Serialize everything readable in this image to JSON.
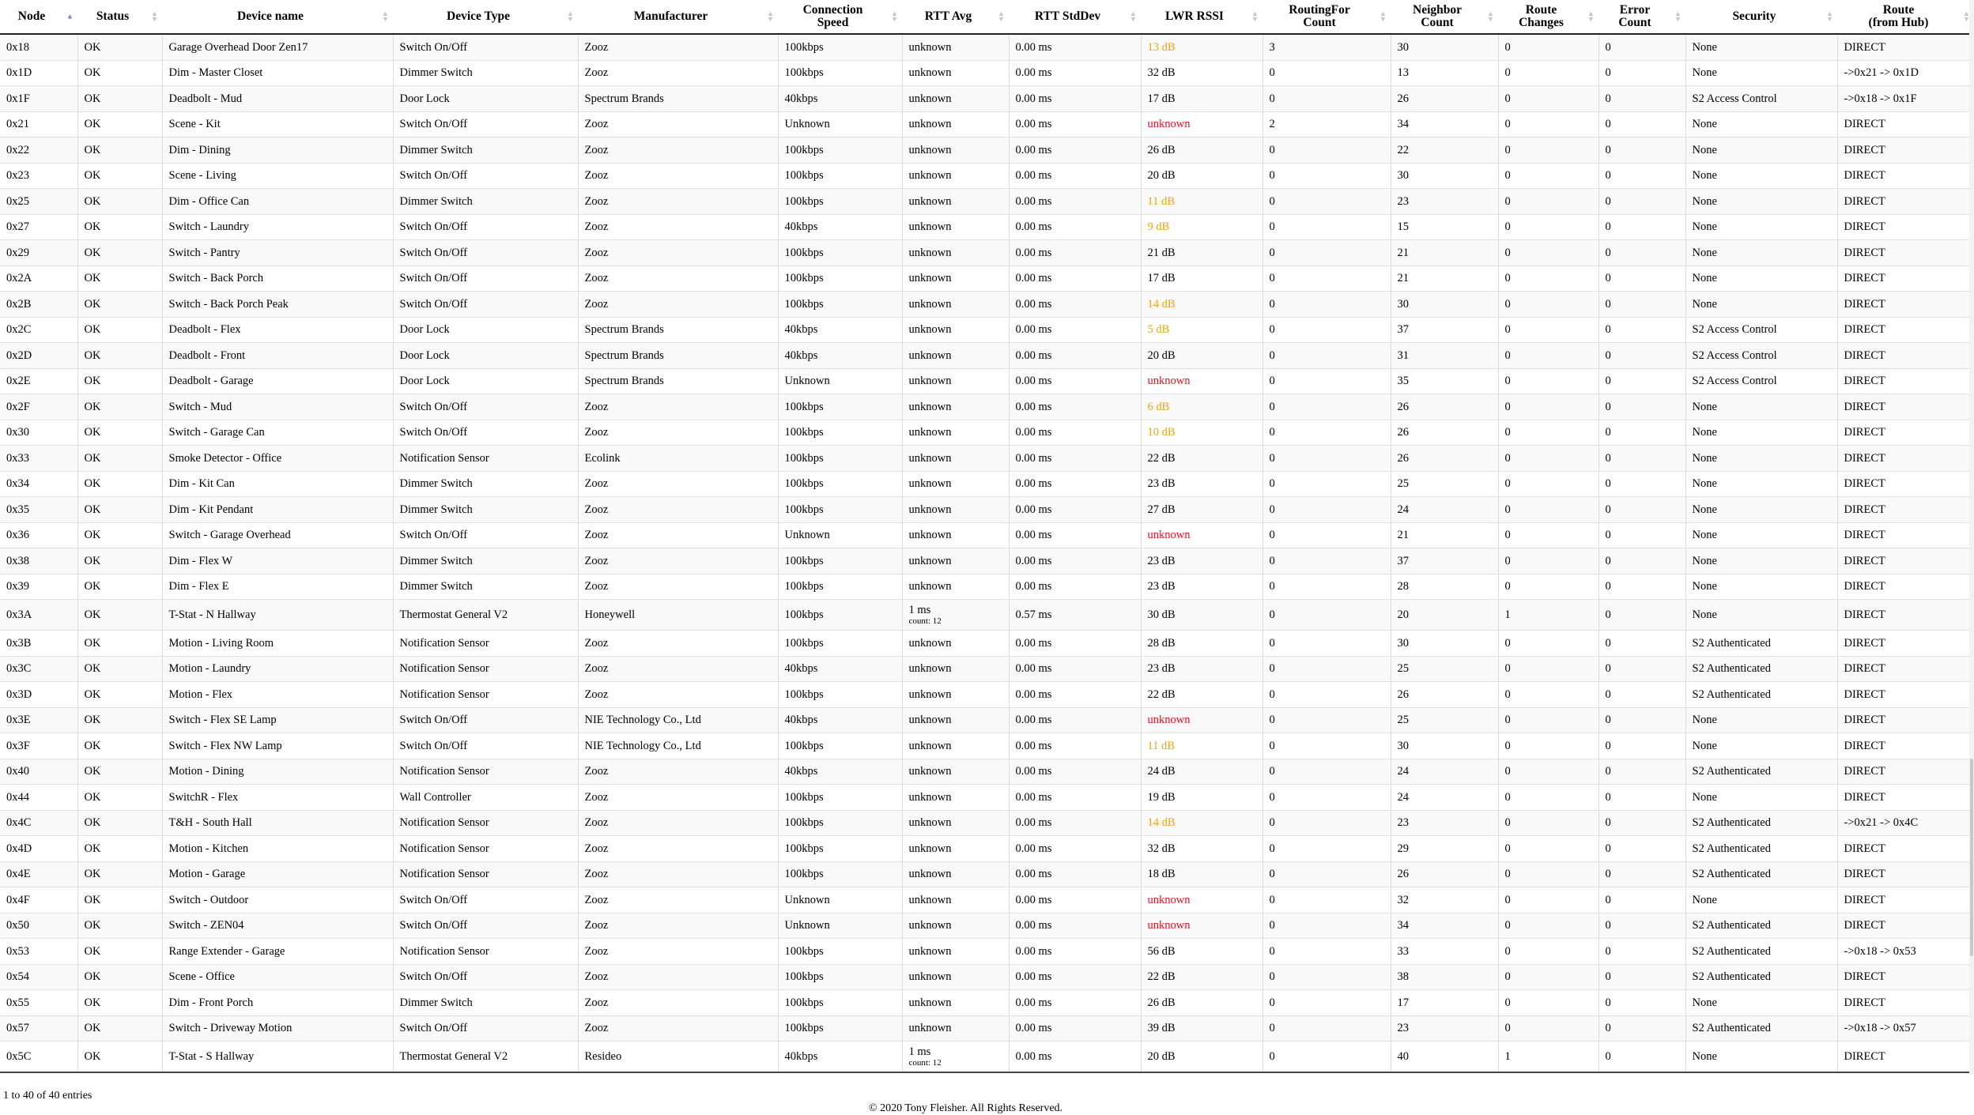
{
  "columns": [
    {
      "key": "node",
      "label": "Node",
      "sort": "asc"
    },
    {
      "key": "status",
      "label": "Status",
      "sort": "none"
    },
    {
      "key": "device_name",
      "label": "Device name",
      "sort": "none"
    },
    {
      "key": "device_type",
      "label": "Device Type",
      "sort": "none"
    },
    {
      "key": "manufacturer",
      "label": "Manufacturer",
      "sort": "none"
    },
    {
      "key": "speed",
      "label": "Connection\nSpeed",
      "sort": "none"
    },
    {
      "key": "rtt_avg",
      "label": "RTT Avg",
      "sort": "none"
    },
    {
      "key": "rtt_std",
      "label": "RTT StdDev",
      "sort": "none"
    },
    {
      "key": "rssi",
      "label": "LWR RSSI",
      "sort": "none"
    },
    {
      "key": "routing",
      "label": "RoutingFor\nCount",
      "sort": "none"
    },
    {
      "key": "neighbor",
      "label": "Neighbor\nCount",
      "sort": "none"
    },
    {
      "key": "route_changes",
      "label": "Route\nChanges",
      "sort": "none"
    },
    {
      "key": "errors",
      "label": "Error\nCount",
      "sort": "none"
    },
    {
      "key": "security",
      "label": "Security",
      "sort": "none"
    },
    {
      "key": "route",
      "label": "Route\n(from Hub)",
      "sort": "none"
    }
  ],
  "rows": [
    {
      "node": "0x18",
      "status": "OK",
      "device_name": "Garage Overhead Door Zen17",
      "device_type": "Switch On/Off",
      "manufacturer": "Zooz",
      "speed": "100kbps",
      "rtt_avg": "unknown",
      "rtt_std": "0.00 ms",
      "rssi": "13 dB",
      "rssi_level": "warn",
      "routing": "3",
      "neighbor": "30",
      "route_changes": "0",
      "errors": "0",
      "security": "None",
      "route": "DIRECT"
    },
    {
      "node": "0x1D",
      "status": "OK",
      "device_name": "Dim - Master Closet",
      "device_type": "Dimmer Switch",
      "manufacturer": "Zooz",
      "speed": "100kbps",
      "rtt_avg": "unknown",
      "rtt_std": "0.00 ms",
      "rssi": "32 dB",
      "rssi_level": "ok",
      "routing": "0",
      "neighbor": "13",
      "route_changes": "0",
      "errors": "0",
      "security": "None",
      "route": "->0x21 -> 0x1D"
    },
    {
      "node": "0x1F",
      "status": "OK",
      "device_name": "Deadbolt - Mud",
      "device_type": "Door Lock",
      "manufacturer": "Spectrum Brands",
      "speed": "40kbps",
      "rtt_avg": "unknown",
      "rtt_std": "0.00 ms",
      "rssi": "17 dB",
      "rssi_level": "ok",
      "routing": "0",
      "neighbor": "26",
      "route_changes": "0",
      "errors": "0",
      "security": "S2 Access Control",
      "route": "->0x18 -> 0x1F"
    },
    {
      "node": "0x21",
      "status": "OK",
      "device_name": "Scene - Kit",
      "device_type": "Switch On/Off",
      "manufacturer": "Zooz",
      "speed": "Unknown",
      "rtt_avg": "unknown",
      "rtt_std": "0.00 ms",
      "rssi": "unknown",
      "rssi_level": "bad",
      "routing": "2",
      "neighbor": "34",
      "route_changes": "0",
      "errors": "0",
      "security": "None",
      "route": "DIRECT"
    },
    {
      "node": "0x22",
      "status": "OK",
      "device_name": "Dim - Dining",
      "device_type": "Dimmer Switch",
      "manufacturer": "Zooz",
      "speed": "100kbps",
      "rtt_avg": "unknown",
      "rtt_std": "0.00 ms",
      "rssi": "26 dB",
      "rssi_level": "ok",
      "routing": "0",
      "neighbor": "22",
      "route_changes": "0",
      "errors": "0",
      "security": "None",
      "route": "DIRECT"
    },
    {
      "node": "0x23",
      "status": "OK",
      "device_name": "Scene - Living",
      "device_type": "Switch On/Off",
      "manufacturer": "Zooz",
      "speed": "100kbps",
      "rtt_avg": "unknown",
      "rtt_std": "0.00 ms",
      "rssi": "20 dB",
      "rssi_level": "ok",
      "routing": "0",
      "neighbor": "30",
      "route_changes": "0",
      "errors": "0",
      "security": "None",
      "route": "DIRECT"
    },
    {
      "node": "0x25",
      "status": "OK",
      "device_name": "Dim - Office Can",
      "device_type": "Dimmer Switch",
      "manufacturer": "Zooz",
      "speed": "100kbps",
      "rtt_avg": "unknown",
      "rtt_std": "0.00 ms",
      "rssi": "11 dB",
      "rssi_level": "warn",
      "routing": "0",
      "neighbor": "23",
      "route_changes": "0",
      "errors": "0",
      "security": "None",
      "route": "DIRECT"
    },
    {
      "node": "0x27",
      "status": "OK",
      "device_name": "Switch - Laundry",
      "device_type": "Switch On/Off",
      "manufacturer": "Zooz",
      "speed": "40kbps",
      "rtt_avg": "unknown",
      "rtt_std": "0.00 ms",
      "rssi": "9 dB",
      "rssi_level": "warn",
      "routing": "0",
      "neighbor": "15",
      "route_changes": "0",
      "errors": "0",
      "security": "None",
      "route": "DIRECT"
    },
    {
      "node": "0x29",
      "status": "OK",
      "device_name": "Switch - Pantry",
      "device_type": "Switch On/Off",
      "manufacturer": "Zooz",
      "speed": "100kbps",
      "rtt_avg": "unknown",
      "rtt_std": "0.00 ms",
      "rssi": "21 dB",
      "rssi_level": "ok",
      "routing": "0",
      "neighbor": "21",
      "route_changes": "0",
      "errors": "0",
      "security": "None",
      "route": "DIRECT"
    },
    {
      "node": "0x2A",
      "status": "OK",
      "device_name": "Switch - Back Porch",
      "device_type": "Switch On/Off",
      "manufacturer": "Zooz",
      "speed": "100kbps",
      "rtt_avg": "unknown",
      "rtt_std": "0.00 ms",
      "rssi": "17 dB",
      "rssi_level": "ok",
      "routing": "0",
      "neighbor": "21",
      "route_changes": "0",
      "errors": "0",
      "security": "None",
      "route": "DIRECT"
    },
    {
      "node": "0x2B",
      "status": "OK",
      "device_name": "Switch - Back Porch Peak",
      "device_type": "Switch On/Off",
      "manufacturer": "Zooz",
      "speed": "100kbps",
      "rtt_avg": "unknown",
      "rtt_std": "0.00 ms",
      "rssi": "14 dB",
      "rssi_level": "warn",
      "routing": "0",
      "neighbor": "30",
      "route_changes": "0",
      "errors": "0",
      "security": "None",
      "route": "DIRECT"
    },
    {
      "node": "0x2C",
      "status": "OK",
      "device_name": "Deadbolt - Flex",
      "device_type": "Door Lock",
      "manufacturer": "Spectrum Brands",
      "speed": "40kbps",
      "rtt_avg": "unknown",
      "rtt_std": "0.00 ms",
      "rssi": "5 dB",
      "rssi_level": "warn",
      "routing": "0",
      "neighbor": "37",
      "route_changes": "0",
      "errors": "0",
      "security": "S2 Access Control",
      "route": "DIRECT"
    },
    {
      "node": "0x2D",
      "status": "OK",
      "device_name": "Deadbolt - Front",
      "device_type": "Door Lock",
      "manufacturer": "Spectrum Brands",
      "speed": "40kbps",
      "rtt_avg": "unknown",
      "rtt_std": "0.00 ms",
      "rssi": "20 dB",
      "rssi_level": "ok",
      "routing": "0",
      "neighbor": "31",
      "route_changes": "0",
      "errors": "0",
      "security": "S2 Access Control",
      "route": "DIRECT"
    },
    {
      "node": "0x2E",
      "status": "OK",
      "device_name": "Deadbolt - Garage",
      "device_type": "Door Lock",
      "manufacturer": "Spectrum Brands",
      "speed": "Unknown",
      "rtt_avg": "unknown",
      "rtt_std": "0.00 ms",
      "rssi": "unknown",
      "rssi_level": "bad",
      "routing": "0",
      "neighbor": "35",
      "route_changes": "0",
      "errors": "0",
      "security": "S2 Access Control",
      "route": "DIRECT"
    },
    {
      "node": "0x2F",
      "status": "OK",
      "device_name": "Switch - Mud",
      "device_type": "Switch On/Off",
      "manufacturer": "Zooz",
      "speed": "100kbps",
      "rtt_avg": "unknown",
      "rtt_std": "0.00 ms",
      "rssi": "6 dB",
      "rssi_level": "warn",
      "routing": "0",
      "neighbor": "26",
      "route_changes": "0",
      "errors": "0",
      "security": "None",
      "route": "DIRECT"
    },
    {
      "node": "0x30",
      "status": "OK",
      "device_name": "Switch - Garage Can",
      "device_type": "Switch On/Off",
      "manufacturer": "Zooz",
      "speed": "100kbps",
      "rtt_avg": "unknown",
      "rtt_std": "0.00 ms",
      "rssi": "10 dB",
      "rssi_level": "warn",
      "routing": "0",
      "neighbor": "26",
      "route_changes": "0",
      "errors": "0",
      "security": "None",
      "route": "DIRECT"
    },
    {
      "node": "0x33",
      "status": "OK",
      "device_name": "Smoke Detector - Office",
      "device_type": "Notification Sensor",
      "manufacturer": "Ecolink",
      "speed": "100kbps",
      "rtt_avg": "unknown",
      "rtt_std": "0.00 ms",
      "rssi": "22 dB",
      "rssi_level": "ok",
      "routing": "0",
      "neighbor": "26",
      "route_changes": "0",
      "errors": "0",
      "security": "None",
      "route": "DIRECT"
    },
    {
      "node": "0x34",
      "status": "OK",
      "device_name": "Dim - Kit Can",
      "device_type": "Dimmer Switch",
      "manufacturer": "Zooz",
      "speed": "100kbps",
      "rtt_avg": "unknown",
      "rtt_std": "0.00 ms",
      "rssi": "23 dB",
      "rssi_level": "ok",
      "routing": "0",
      "neighbor": "25",
      "route_changes": "0",
      "errors": "0",
      "security": "None",
      "route": "DIRECT"
    },
    {
      "node": "0x35",
      "status": "OK",
      "device_name": "Dim - Kit Pendant",
      "device_type": "Dimmer Switch",
      "manufacturer": "Zooz",
      "speed": "100kbps",
      "rtt_avg": "unknown",
      "rtt_std": "0.00 ms",
      "rssi": "27 dB",
      "rssi_level": "ok",
      "routing": "0",
      "neighbor": "24",
      "route_changes": "0",
      "errors": "0",
      "security": "None",
      "route": "DIRECT"
    },
    {
      "node": "0x36",
      "status": "OK",
      "device_name": "Switch - Garage Overhead",
      "device_type": "Switch On/Off",
      "manufacturer": "Zooz",
      "speed": "Unknown",
      "rtt_avg": "unknown",
      "rtt_std": "0.00 ms",
      "rssi": "unknown",
      "rssi_level": "bad",
      "routing": "0",
      "neighbor": "21",
      "route_changes": "0",
      "errors": "0",
      "security": "None",
      "route": "DIRECT"
    },
    {
      "node": "0x38",
      "status": "OK",
      "device_name": "Dim - Flex W",
      "device_type": "Dimmer Switch",
      "manufacturer": "Zooz",
      "speed": "100kbps",
      "rtt_avg": "unknown",
      "rtt_std": "0.00 ms",
      "rssi": "23 dB",
      "rssi_level": "ok",
      "routing": "0",
      "neighbor": "37",
      "route_changes": "0",
      "errors": "0",
      "security": "None",
      "route": "DIRECT"
    },
    {
      "node": "0x39",
      "status": "OK",
      "device_name": "Dim - Flex E",
      "device_type": "Dimmer Switch",
      "manufacturer": "Zooz",
      "speed": "100kbps",
      "rtt_avg": "unknown",
      "rtt_std": "0.00 ms",
      "rssi": "23 dB",
      "rssi_level": "ok",
      "routing": "0",
      "neighbor": "28",
      "route_changes": "0",
      "errors": "0",
      "security": "None",
      "route": "DIRECT"
    },
    {
      "node": "0x3A",
      "status": "OK",
      "device_name": "T-Stat - N Hallway",
      "device_type": "Thermostat General V2",
      "manufacturer": "Honeywell",
      "speed": "100kbps",
      "rtt_avg": "1 ms",
      "rtt_count": "count: 12",
      "rtt_std": "0.57 ms",
      "rssi": "30 dB",
      "rssi_level": "ok",
      "routing": "0",
      "neighbor": "20",
      "route_changes": "1",
      "errors": "0",
      "security": "None",
      "route": "DIRECT"
    },
    {
      "node": "0x3B",
      "status": "OK",
      "device_name": "Motion - Living Room",
      "device_type": "Notification Sensor",
      "manufacturer": "Zooz",
      "speed": "100kbps",
      "rtt_avg": "unknown",
      "rtt_std": "0.00 ms",
      "rssi": "28 dB",
      "rssi_level": "ok",
      "routing": "0",
      "neighbor": "30",
      "route_changes": "0",
      "errors": "0",
      "security": "S2 Authenticated",
      "route": "DIRECT"
    },
    {
      "node": "0x3C",
      "status": "OK",
      "device_name": "Motion - Laundry",
      "device_type": "Notification Sensor",
      "manufacturer": "Zooz",
      "speed": "40kbps",
      "rtt_avg": "unknown",
      "rtt_std": "0.00 ms",
      "rssi": "23 dB",
      "rssi_level": "ok",
      "routing": "0",
      "neighbor": "25",
      "route_changes": "0",
      "errors": "0",
      "security": "S2 Authenticated",
      "route": "DIRECT"
    },
    {
      "node": "0x3D",
      "status": "OK",
      "device_name": "Motion - Flex",
      "device_type": "Notification Sensor",
      "manufacturer": "Zooz",
      "speed": "100kbps",
      "rtt_avg": "unknown",
      "rtt_std": "0.00 ms",
      "rssi": "22 dB",
      "rssi_level": "ok",
      "routing": "0",
      "neighbor": "26",
      "route_changes": "0",
      "errors": "0",
      "security": "S2 Authenticated",
      "route": "DIRECT"
    },
    {
      "node": "0x3E",
      "status": "OK",
      "device_name": "Switch - Flex SE Lamp",
      "device_type": "Switch On/Off",
      "manufacturer": "NIE Technology Co., Ltd",
      "speed": "40kbps",
      "rtt_avg": "unknown",
      "rtt_std": "0.00 ms",
      "rssi": "unknown",
      "rssi_level": "bad",
      "routing": "0",
      "neighbor": "25",
      "route_changes": "0",
      "errors": "0",
      "security": "None",
      "route": "DIRECT"
    },
    {
      "node": "0x3F",
      "status": "OK",
      "device_name": "Switch - Flex NW Lamp",
      "device_type": "Switch On/Off",
      "manufacturer": "NIE Technology Co., Ltd",
      "speed": "100kbps",
      "rtt_avg": "unknown",
      "rtt_std": "0.00 ms",
      "rssi": "11 dB",
      "rssi_level": "warn",
      "routing": "0",
      "neighbor": "30",
      "route_changes": "0",
      "errors": "0",
      "security": "None",
      "route": "DIRECT"
    },
    {
      "node": "0x40",
      "status": "OK",
      "device_name": "Motion - Dining",
      "device_type": "Notification Sensor",
      "manufacturer": "Zooz",
      "speed": "40kbps",
      "rtt_avg": "unknown",
      "rtt_std": "0.00 ms",
      "rssi": "24 dB",
      "rssi_level": "ok",
      "routing": "0",
      "neighbor": "24",
      "route_changes": "0",
      "errors": "0",
      "security": "S2 Authenticated",
      "route": "DIRECT"
    },
    {
      "node": "0x44",
      "status": "OK",
      "device_name": "SwitchR - Flex",
      "device_type": "Wall Controller",
      "manufacturer": "Zooz",
      "speed": "100kbps",
      "rtt_avg": "unknown",
      "rtt_std": "0.00 ms",
      "rssi": "19 dB",
      "rssi_level": "ok",
      "routing": "0",
      "neighbor": "24",
      "route_changes": "0",
      "errors": "0",
      "security": "None",
      "route": "DIRECT"
    },
    {
      "node": "0x4C",
      "status": "OK",
      "device_name": "T&H - South Hall",
      "device_type": "Notification Sensor",
      "manufacturer": "Zooz",
      "speed": "100kbps",
      "rtt_avg": "unknown",
      "rtt_std": "0.00 ms",
      "rssi": "14 dB",
      "rssi_level": "warn",
      "routing": "0",
      "neighbor": "23",
      "route_changes": "0",
      "errors": "0",
      "security": "S2 Authenticated",
      "route": "->0x21 -> 0x4C"
    },
    {
      "node": "0x4D",
      "status": "OK",
      "device_name": "Motion - Kitchen",
      "device_type": "Notification Sensor",
      "manufacturer": "Zooz",
      "speed": "100kbps",
      "rtt_avg": "unknown",
      "rtt_std": "0.00 ms",
      "rssi": "32 dB",
      "rssi_level": "ok",
      "routing": "0",
      "neighbor": "29",
      "route_changes": "0",
      "errors": "0",
      "security": "S2 Authenticated",
      "route": "DIRECT"
    },
    {
      "node": "0x4E",
      "status": "OK",
      "device_name": "Motion - Garage",
      "device_type": "Notification Sensor",
      "manufacturer": "Zooz",
      "speed": "100kbps",
      "rtt_avg": "unknown",
      "rtt_std": "0.00 ms",
      "rssi": "18 dB",
      "rssi_level": "ok",
      "routing": "0",
      "neighbor": "26",
      "route_changes": "0",
      "errors": "0",
      "security": "S2 Authenticated",
      "route": "DIRECT"
    },
    {
      "node": "0x4F",
      "status": "OK",
      "device_name": "Switch - Outdoor",
      "device_type": "Switch On/Off",
      "manufacturer": "Zooz",
      "speed": "Unknown",
      "rtt_avg": "unknown",
      "rtt_std": "0.00 ms",
      "rssi": "unknown",
      "rssi_level": "bad",
      "routing": "0",
      "neighbor": "32",
      "route_changes": "0",
      "errors": "0",
      "security": "None",
      "route": "DIRECT"
    },
    {
      "node": "0x50",
      "status": "OK",
      "device_name": "Switch - ZEN04",
      "device_type": "Switch On/Off",
      "manufacturer": "Zooz",
      "speed": "Unknown",
      "rtt_avg": "unknown",
      "rtt_std": "0.00 ms",
      "rssi": "unknown",
      "rssi_level": "bad",
      "routing": "0",
      "neighbor": "34",
      "route_changes": "0",
      "errors": "0",
      "security": "S2 Authenticated",
      "route": "DIRECT"
    },
    {
      "node": "0x53",
      "status": "OK",
      "device_name": "Range Extender - Garage",
      "device_type": "Notification Sensor",
      "manufacturer": "Zooz",
      "speed": "100kbps",
      "rtt_avg": "unknown",
      "rtt_std": "0.00 ms",
      "rssi": "56 dB",
      "rssi_level": "ok",
      "routing": "0",
      "neighbor": "33",
      "route_changes": "0",
      "errors": "0",
      "security": "S2 Authenticated",
      "route": "->0x18 -> 0x53"
    },
    {
      "node": "0x54",
      "status": "OK",
      "device_name": "Scene - Office",
      "device_type": "Switch On/Off",
      "manufacturer": "Zooz",
      "speed": "100kbps",
      "rtt_avg": "unknown",
      "rtt_std": "0.00 ms",
      "rssi": "22 dB",
      "rssi_level": "ok",
      "routing": "0",
      "neighbor": "38",
      "route_changes": "0",
      "errors": "0",
      "security": "S2 Authenticated",
      "route": "DIRECT"
    },
    {
      "node": "0x55",
      "status": "OK",
      "device_name": "Dim - Front Porch",
      "device_type": "Dimmer Switch",
      "manufacturer": "Zooz",
      "speed": "100kbps",
      "rtt_avg": "unknown",
      "rtt_std": "0.00 ms",
      "rssi": "26 dB",
      "rssi_level": "ok",
      "routing": "0",
      "neighbor": "17",
      "route_changes": "0",
      "errors": "0",
      "security": "None",
      "route": "DIRECT"
    },
    {
      "node": "0x57",
      "status": "OK",
      "device_name": "Switch - Driveway Motion",
      "device_type": "Switch On/Off",
      "manufacturer": "Zooz",
      "speed": "100kbps",
      "rtt_avg": "unknown",
      "rtt_std": "0.00 ms",
      "rssi": "39 dB",
      "rssi_level": "ok",
      "routing": "0",
      "neighbor": "23",
      "route_changes": "0",
      "errors": "0",
      "security": "S2 Authenticated",
      "route": "->0x18 -> 0x57"
    },
    {
      "node": "0x5C",
      "status": "OK",
      "device_name": "T-Stat - S Hallway",
      "device_type": "Thermostat General V2",
      "manufacturer": "Resideo",
      "speed": "40kbps",
      "rtt_avg": "1 ms",
      "rtt_count": "count: 12",
      "rtt_std": "0.00 ms",
      "rssi": "20 dB",
      "rssi_level": "ok",
      "routing": "0",
      "neighbor": "40",
      "route_changes": "1",
      "errors": "0",
      "security": "None",
      "route": "DIRECT"
    }
  ],
  "info_text": "1 to 40 of 40 entries",
  "footer_text": "© 2020 Tony Fleisher. All Rights Reserved.",
  "colors": {
    "rssi_warn": "#f0a30a",
    "rssi_bad": "#e8101a",
    "sort_active": "#6b7bd6",
    "sort_inactive": "#c4c4c4"
  },
  "icons": {
    "sort_asc": "sort-asc-icon",
    "sort_none": "sort-both-icon"
  }
}
